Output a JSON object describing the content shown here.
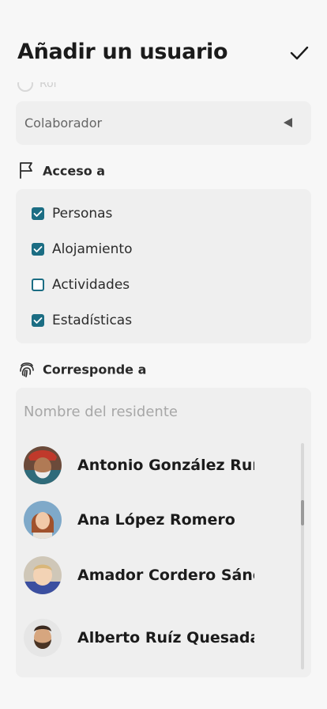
{
  "header": {
    "title": "Añadir un usuario"
  },
  "ghost": {
    "label": "Rol"
  },
  "role": {
    "value": "Colaborador"
  },
  "access": {
    "label": "Acceso a",
    "items": [
      {
        "label": "Personas",
        "checked": true
      },
      {
        "label": "Alojamiento",
        "checked": true
      },
      {
        "label": "Actividades",
        "checked": false
      },
      {
        "label": "Estadísticas",
        "checked": true
      }
    ]
  },
  "corresponds": {
    "label": "Corresponde a",
    "placeholder": "Nombre del residente",
    "residents": [
      {
        "name": "Antonio González Ruíz"
      },
      {
        "name": "Ana López Romero"
      },
      {
        "name": "Amador Cordero Sánchez"
      },
      {
        "name": "Alberto Ruíz Quesada"
      }
    ]
  },
  "colors": {
    "accent": "#1b6d83",
    "panel": "#efefef",
    "background": "#f7f7f7"
  }
}
